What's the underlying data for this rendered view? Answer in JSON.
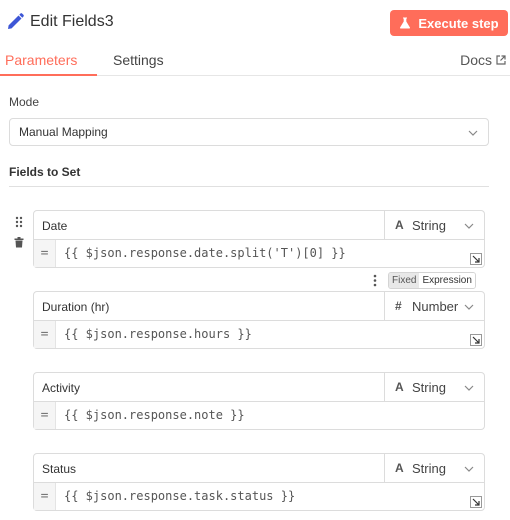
{
  "header": {
    "title": "Edit Fields3",
    "execute_label": "Execute step",
    "icons": {
      "title": "pencil-icon",
      "execute": "flask-icon"
    },
    "accent": "#ff6d5a"
  },
  "tabs": {
    "parameters": "Parameters",
    "settings": "Settings",
    "docs": "Docs",
    "active": "parameters"
  },
  "mode": {
    "label": "Mode",
    "value": "Manual Mapping"
  },
  "fields_section": {
    "label": "Fields to Set",
    "toggle": {
      "fixed": "Fixed",
      "expression": "Expression"
    },
    "fields": [
      {
        "name": "Date",
        "type_glyph": "A",
        "type": "String",
        "value": "{{ $json.response.date.split('T')[0] }}"
      },
      {
        "name": "Duration (hr)",
        "type_glyph": "#",
        "type": "Number",
        "value": "{{ $json.response.hours }}"
      },
      {
        "name": "Activity",
        "type_glyph": "A",
        "type": "String",
        "value": "{{ $json.response.note }}"
      },
      {
        "name": "Status",
        "type_glyph": "A",
        "type": "String",
        "value": "{{ $json.response.task.status }}"
      }
    ]
  }
}
